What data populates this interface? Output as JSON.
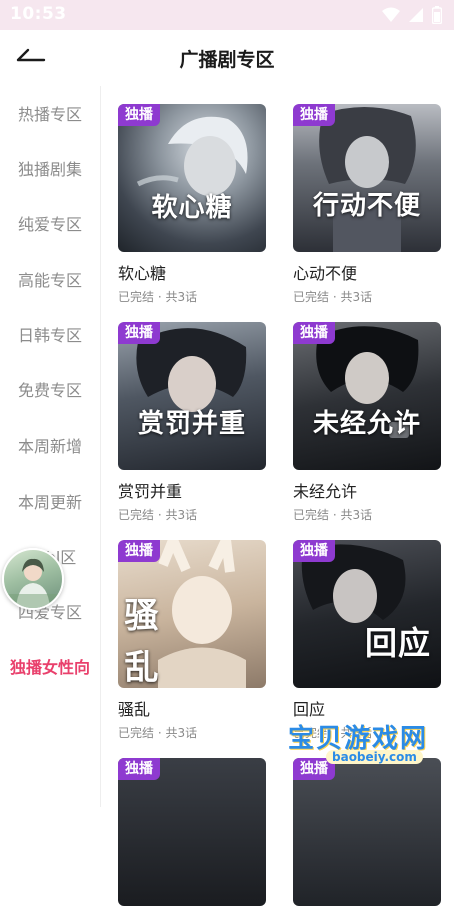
{
  "status_bar": {
    "time": "10:53"
  },
  "header": {
    "title": "广播剧专区"
  },
  "sidebar": {
    "items": [
      {
        "label": "热播专区"
      },
      {
        "label": "独播剧集"
      },
      {
        "label": "纯爱专区"
      },
      {
        "label": "高能专区"
      },
      {
        "label": "日韩专区"
      },
      {
        "label": "免费专区"
      },
      {
        "label": "本周新增"
      },
      {
        "label": "本周更新"
      },
      {
        "label": "bl区"
      },
      {
        "label": "四爱专区"
      },
      {
        "label": "独播女性向"
      }
    ],
    "active_index": 10
  },
  "cards": [
    {
      "badge": "独播",
      "cover_text": "软心糖",
      "title": "软心糖",
      "subtitle": "已完结 · 共3话"
    },
    {
      "badge": "独播",
      "cover_text": "行动不便",
      "title": "心动不便",
      "subtitle": "已完结 · 共3话"
    },
    {
      "badge": "独播",
      "cover_text": "赏罚并重",
      "title": "赏罚并重",
      "subtitle": "已完结 · 共3话"
    },
    {
      "badge": "独播",
      "cover_text": "未经允许",
      "title": "未经允许",
      "subtitle": "已完结 · 共3话"
    },
    {
      "badge": "独播",
      "cover_text_1": "骚",
      "cover_text_2": "乱",
      "title": "骚乱",
      "subtitle": "已完结 · 共3话"
    },
    {
      "badge": "独播",
      "cover_text": "回应",
      "title": "回应",
      "subtitle": "已完结 · 共3话"
    },
    {
      "badge": "独播"
    },
    {
      "badge": "独播"
    }
  ],
  "watermark": {
    "text": "宝贝游戏网",
    "url": "baobeiy.com"
  },
  "colors": {
    "accent": "#e9406c",
    "badge": "#8e3ad0",
    "status_bar": "#f6e7ef"
  }
}
